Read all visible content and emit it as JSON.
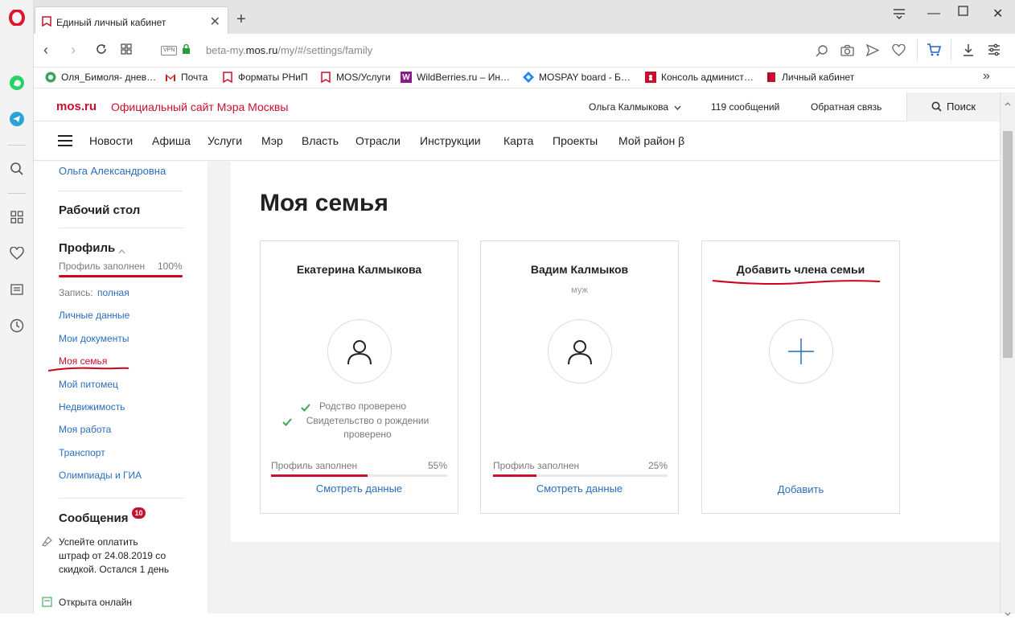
{
  "browser": {
    "tab_title": "Единый личный кабинет",
    "url_prefix": "beta-my.",
    "url_domain": "mos.ru",
    "url_path": "/my/#/settings/family",
    "vpn_label": "VPN",
    "bookmarks": [
      {
        "label": "Оля_Бимоля- днев…",
        "icon": "green-circle-icon",
        "color": "#3aa655"
      },
      {
        "label": "Почта",
        "icon": "gmail-icon",
        "color": "#c5221f"
      },
      {
        "label": "Форматы РНиП",
        "icon": "red-bookmark-icon",
        "color": "#c8102e"
      },
      {
        "label": "MOS/Услуги",
        "icon": "red-bookmark-icon",
        "color": "#c8102e"
      },
      {
        "label": "WildBerries.ru – Ин…",
        "icon": "wildberries-icon",
        "color": "#8b1a8b"
      },
      {
        "label": "MOSPAY board - Б…",
        "icon": "jira-diamond-icon",
        "color": "#2684ff"
      },
      {
        "label": "Консоль админист…",
        "icon": "moscow-emblem-icon",
        "color": "#c8102e"
      },
      {
        "label": "Личный кабинет",
        "icon": "book-icon",
        "color": "#c8102e"
      }
    ],
    "bookmarks_more": "»"
  },
  "site": {
    "logo": "mos.ru",
    "tagline": "Официальный сайт Мэра Москвы",
    "user_name": "Ольга Калмыкова",
    "messages_link": "119 сообщений",
    "feedback_link": "Обратная связь",
    "search_label": "Поиск",
    "nav": [
      "Новости",
      "Афиша",
      "Услуги",
      "Мэр",
      "Власть",
      "Отрасли",
      "Инструкции",
      "Карта",
      "Проекты",
      "Мой район β"
    ]
  },
  "sidebar": {
    "patronymic": "Ольга Александровна",
    "desktop": "Рабочий стол",
    "profile_title": "Профиль",
    "profile_filled_label": "Профиль заполнен",
    "profile_filled_value": "100%",
    "record_label": "Запись:",
    "record_value": "полная",
    "links": [
      "Личные данные",
      "Мои документы",
      "Моя семья",
      "Мой питомец",
      "Недвижимость",
      "Моя работа",
      "Транспорт",
      "Олимпиады и ГИА"
    ],
    "messages_title": "Сообщения",
    "messages_badge": "10",
    "message1": "Успейте оплатить штраф от 24.08.2019 со скидкой. Остался 1 день",
    "message2": "Открыта онлайн"
  },
  "page": {
    "title": "Моя семья",
    "cards": [
      {
        "name": "Екатерина Калмыкова",
        "relation": "",
        "checks": [
          "Родство проверено",
          "Свидетельство о рождении проверено"
        ],
        "progress_label": "Профиль заполнен",
        "progress_value": "55%",
        "progress_fraction": 0.55,
        "action": "Смотреть данные"
      },
      {
        "name": "Вадим Калмыков",
        "relation": "муж",
        "checks": [],
        "progress_label": "Профиль заполнен",
        "progress_value": "25%",
        "progress_fraction": 0.25,
        "action": "Смотреть данные"
      }
    ],
    "add_card": {
      "title": "Добавить члена семьи",
      "action": "Добавить"
    }
  },
  "colors": {
    "brand_red": "#c8102e",
    "link_blue": "#2a6ebb",
    "check_green": "#3aa655",
    "annotation_red": "#d0021b"
  }
}
